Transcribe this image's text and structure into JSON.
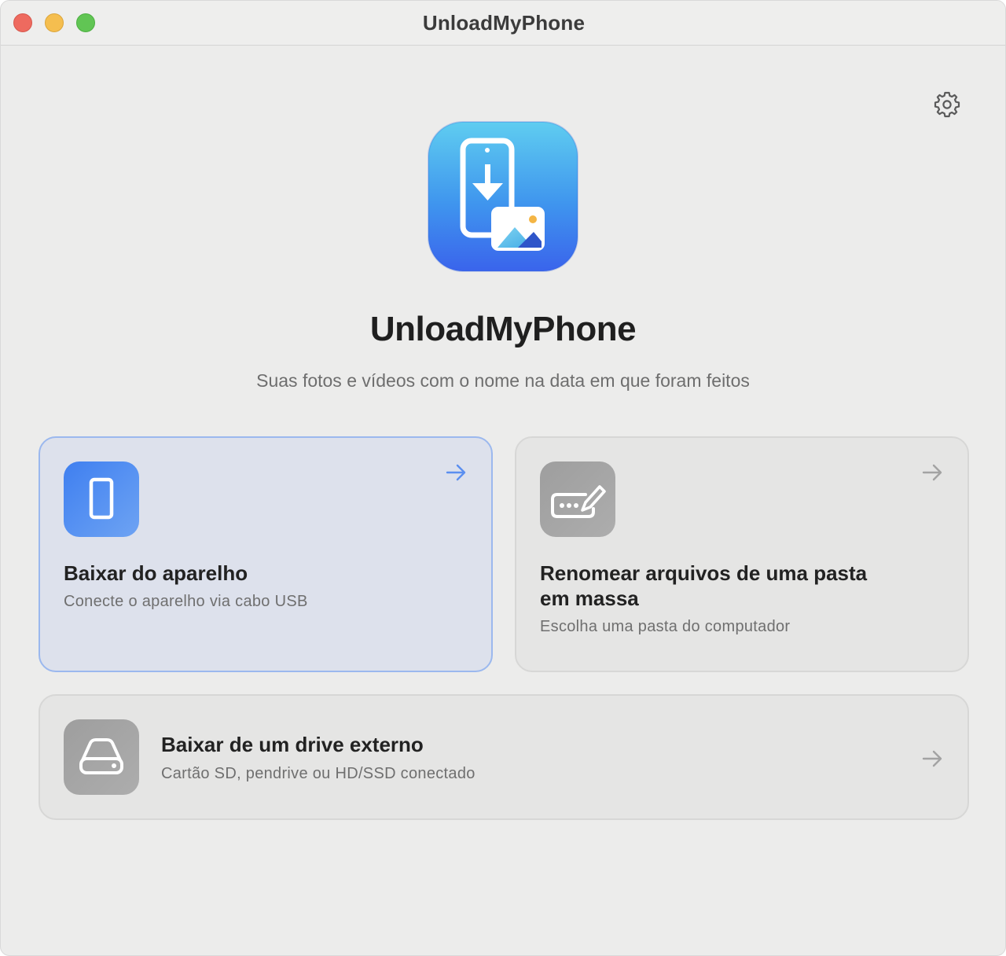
{
  "window": {
    "title": "UnloadMyPhone"
  },
  "header": {
    "app_name": "UnloadMyPhone",
    "tagline": "Suas fotos e vídeos com o nome na data em que foram feitos"
  },
  "icons": {
    "settings": "gear-icon",
    "app": "phone-download-photo-icon",
    "device": "smartphone-icon",
    "rename": "rename-keyboard-pencil-icon",
    "drive": "external-drive-icon",
    "arrow": "arrow-right-icon"
  },
  "options": {
    "device": {
      "title": "Baixar do aparelho",
      "subtitle": "Conecte o aparelho via cabo USB"
    },
    "rename": {
      "title_line1": "Renomear arquivos de uma pasta",
      "title_line2": "em massa",
      "subtitle": "Escolha uma pasta do computador"
    },
    "drive": {
      "title": "Baixar de um drive externo",
      "subtitle": "Cartão SD, pendrive ou HD/SSD conectado"
    }
  },
  "colors": {
    "accent": "#3f7ff0",
    "selected_card_bg": "#dde1ec",
    "selected_card_border": "#9bb8ee"
  }
}
